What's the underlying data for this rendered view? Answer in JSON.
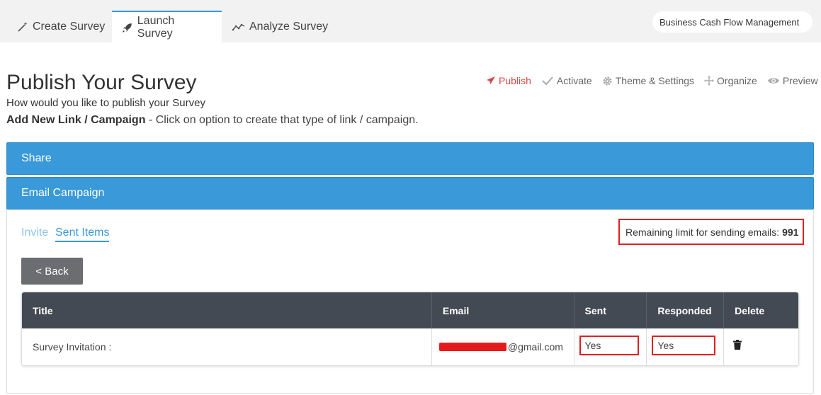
{
  "nav": {
    "tabs": [
      {
        "label": "Create Survey",
        "icon": "magic-wand-icon"
      },
      {
        "label": "Launch Survey",
        "icon": "rocket-icon",
        "active": true
      },
      {
        "label": "Analyze Survey",
        "icon": "line-chart-icon"
      }
    ],
    "project_name": "Business Cash Flow Management"
  },
  "header": {
    "title": "Publish Your Survey",
    "subtitle": "How would you like to publish your Survey",
    "hint_bold": "Add New Link / Campaign",
    "hint_rest": " - Click on option to create that type of link / campaign."
  },
  "steps": [
    {
      "label": "Publish",
      "icon": "paper-plane-icon",
      "active": true
    },
    {
      "label": "Activate",
      "icon": "check-icon"
    },
    {
      "label": "Theme & Settings",
      "icon": "gear-icon"
    },
    {
      "label": "Organize",
      "icon": "move-icon"
    },
    {
      "label": "Preview",
      "icon": "eye-icon"
    }
  ],
  "panels": {
    "share": "Share",
    "email": "Email Campaign"
  },
  "email_campaign": {
    "tabs": {
      "invite": "Invite",
      "sent": "Sent Items"
    },
    "limit_label": "Remaining limit for sending emails:",
    "limit_value": "991",
    "back_label": "< Back",
    "table": {
      "headers": [
        "Title",
        "Email",
        "Sent",
        "Responded",
        "Delete"
      ],
      "rows": [
        {
          "title": "Survey Invitation :",
          "email_domain": "@gmail.com",
          "sent": "Yes",
          "responded": "Yes"
        }
      ]
    }
  },
  "colors": {
    "accent": "#3a99d8",
    "header_dark": "#434a54",
    "highlight_red": "#e02020",
    "publish_red": "#d04a4a"
  }
}
